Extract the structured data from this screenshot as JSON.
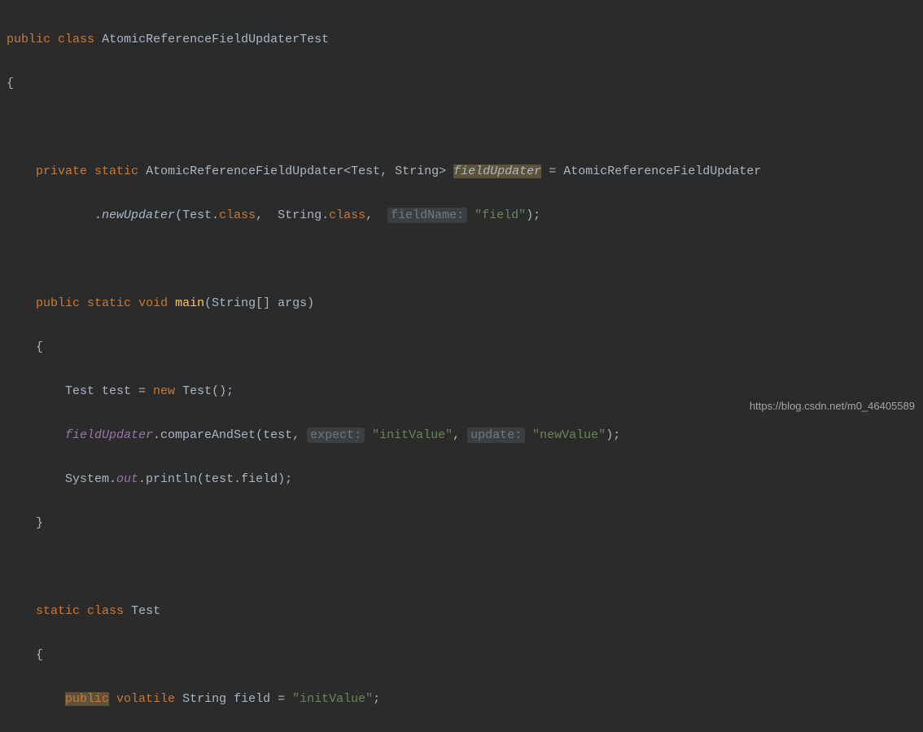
{
  "code": {
    "l1_public": "public",
    "l1_class": "class",
    "l1_name": "AtomicReferenceFieldUpdaterTest",
    "l2_brace": "{",
    "l4_private": "private",
    "l4_static": "static",
    "l4_type": "AtomicReferenceFieldUpdater<Test, String>",
    "l4_field": "fieldUpdater",
    "l4_eq": " = AtomicReferenceFieldUpdater",
    "l5_dot": ".",
    "l5_method": "newUpdater",
    "l5_arg1a": "(Test.",
    "l5_arg1b": "class",
    "l5_sep1": ",  String.",
    "l5_arg2b": "class",
    "l5_sep2": ",  ",
    "l5_hint": "fieldName:",
    "l5_str": " \"field\"",
    "l5_end": ");",
    "l7_public": "public",
    "l7_static": "static",
    "l7_void": "void",
    "l7_main": "main",
    "l7_args": "(String[] args)",
    "l8_brace": "{",
    "l9_test": "Test test = ",
    "l9_new": "new",
    "l9_rest": " Test();",
    "l10_field": "fieldUpdater",
    "l10_call": ".compareAndSet(test, ",
    "l10_hint1": "expect:",
    "l10_str1": " \"initValue\"",
    "l10_sep": ", ",
    "l10_hint2": "update:",
    "l10_str2": " \"newValue\"",
    "l10_end": ");",
    "l11_sys": "System.",
    "l11_out": "out",
    "l11_println": ".println(test.field);",
    "l12_brace": "}",
    "l14_static": "static",
    "l14_class": "class",
    "l14_name": "Test",
    "l15_brace": "{",
    "l16_public": "public",
    "l16_volatile": "volatile",
    "l16_type": " String field = ",
    "l16_str": "\"initValue\"",
    "l16_end": ";"
  },
  "watermark": "https://blog.csdn.net/m0_46405589"
}
